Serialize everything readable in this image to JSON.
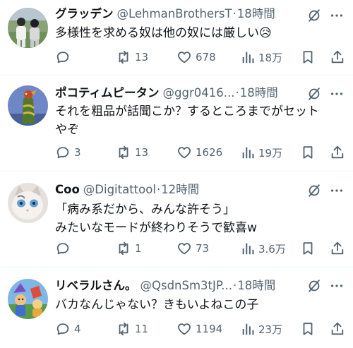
{
  "colors": {
    "text": "#0f1419",
    "muted": "#536471",
    "divider": "#eff3f4",
    "background": "#ffffff"
  },
  "tweets": [
    {
      "display_name": "グラッデン",
      "handle": "@LehmanBrothersT",
      "separator": "·",
      "time": "18時間",
      "lines": [
        "多様性を求める奴は他の奴には厳しい😥"
      ],
      "replies": "",
      "retweets": "13",
      "likes": "678",
      "views": "18万",
      "avatar_icon": "baseball-players-avatar"
    },
    {
      "display_name": "ポコティムピータン",
      "handle": "@ggr0416...",
      "separator": "·",
      "time": "18時間",
      "lines": [
        "それを粗品が話聞こか？するところまでがセット",
        "やぞ"
      ],
      "replies": "3",
      "retweets": "13",
      "likes": "1626",
      "views": "19万",
      "avatar_icon": "dragon-tower-avatar"
    },
    {
      "display_name": "Coo",
      "handle": "@Digitattool",
      "separator": "·",
      "time": "12時間",
      "lines": [
        "「病み系だから、みんな許そう」",
        "みたいなモードが終わりそうで歓喜w"
      ],
      "replies": "",
      "retweets": "1",
      "likes": "73",
      "views": "3.6万",
      "avatar_icon": "cat-avatar"
    },
    {
      "display_name": "リベラルさん。",
      "handle": "@QsdnSm3tJP...",
      "separator": "·",
      "time": "18時間",
      "lines": [
        "バカなんじゃない？きもいよねこの子"
      ],
      "replies": "4",
      "retweets": "11",
      "likes": "1194",
      "views": "23万",
      "avatar_icon": "game-character-avatar"
    }
  ]
}
